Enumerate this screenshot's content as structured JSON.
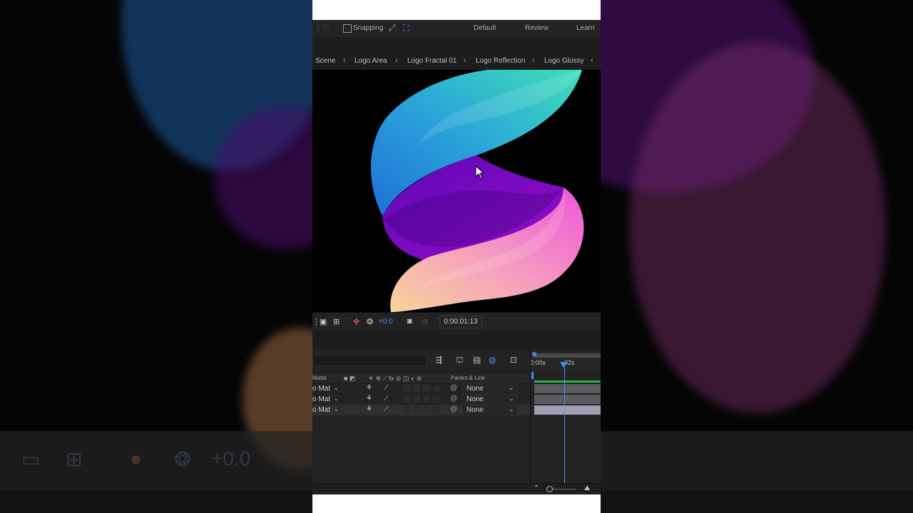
{
  "app_top": {
    "cut_label": "...Snap..."
  },
  "toolbar": {
    "snapping_label": "Snapping",
    "workspaces": [
      "Default",
      "Review",
      "Learn"
    ]
  },
  "comp_tabs": [
    {
      "label": "Scene"
    },
    {
      "label": "Logo Area"
    },
    {
      "label": "Logo Fractal 01"
    },
    {
      "label": "Logo Reflection"
    },
    {
      "label": "Logo Glossy"
    }
  ],
  "viewer": {
    "exposure": "+0.0",
    "timecode": "0:00:01:13"
  },
  "timeline": {
    "ruler_labels": [
      "0:00s",
      "02s"
    ],
    "columns": {
      "matte": "Matte",
      "parent_link": "Parent & Link"
    },
    "layers": [
      {
        "matte": "o Mat",
        "parent": "None",
        "highlighted": false
      },
      {
        "matte": "o Mat",
        "parent": "None",
        "highlighted": false
      },
      {
        "matte": "o Mat",
        "parent": "None",
        "highlighted": true
      }
    ]
  },
  "icons": {
    "snap": "checkbox",
    "snap_tool_a": "snap-tool-icon",
    "snap_tool_b": "snap-feature-icon",
    "viewer_region": "region-of-interest-icon",
    "viewer_grid": "grid-icon",
    "viewer_color": "color-channels-icon",
    "viewer_exposure": "exposure-icon",
    "viewer_camera": "snapshot-icon"
  },
  "colors": {
    "accent": "#3f8ff0",
    "panel": "#232323",
    "track_green": "#28b34b"
  }
}
